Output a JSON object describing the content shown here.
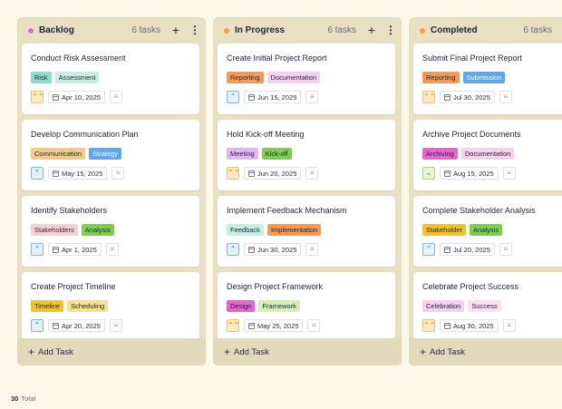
{
  "columns": [
    {
      "title": "Backlog",
      "count": "6 tasks",
      "dot_color": "#d96ad6",
      "add_label": "Add Task",
      "cards": [
        {
          "title": "Conduct Risk Assessment",
          "tags": [
            {
              "label": "Risk",
              "bg": "#8fdcc9"
            },
            {
              "label": "Assessment",
              "bg": "#c6efe2"
            }
          ],
          "priority": "high",
          "date": "Apr 10, 2025"
        },
        {
          "title": "Develop Communication Plan",
          "tags": [
            {
              "label": "Communication",
              "bg": "#f5cb83"
            },
            {
              "label": "Strategy",
              "bg": "#5aa9ef",
              "fg": "#ffffff"
            }
          ],
          "priority": "medium",
          "date": "May 15, 2025"
        },
        {
          "title": "Identify Stakeholders",
          "tags": [
            {
              "label": "Stakeholders",
              "bg": "#f7d0d4"
            },
            {
              "label": "Analysis",
              "bg": "#7bd14b"
            }
          ],
          "priority": "medium",
          "date": "Apr 1, 2025"
        },
        {
          "title": "Create Project Timeline",
          "tags": [
            {
              "label": "Timeline",
              "bg": "#f6c324"
            },
            {
              "label": "Scheduling",
              "bg": "#f8e18c"
            }
          ],
          "priority": "medium",
          "date": "Apr 20, 2025"
        }
      ]
    },
    {
      "title": "In Progress",
      "count": "6 tasks",
      "dot_color": "#f2a23a",
      "add_label": "Add Task",
      "cards": [
        {
          "title": "Create Initial Project Report",
          "tags": [
            {
              "label": "Reporting",
              "bg": "#f59a52"
            },
            {
              "label": "Documentation",
              "bg": "#f7d0ec"
            }
          ],
          "priority": "medium",
          "date": "Jun 15, 2025"
        },
        {
          "title": "Hold Kick-off Meeting",
          "tags": [
            {
              "label": "Meeting",
              "bg": "#e2b6f2"
            },
            {
              "label": "Kick-off",
              "bg": "#7bd14b"
            }
          ],
          "priority": "high",
          "date": "Jun 20, 2025"
        },
        {
          "title": "Implement Feedback Mechanism",
          "tags": [
            {
              "label": "Feedback",
              "bg": "#c6efe2"
            },
            {
              "label": "Implementation",
              "bg": "#f59a52"
            }
          ],
          "priority": "medium",
          "date": "Jun 30, 2025"
        },
        {
          "title": "Design Project Framework",
          "tags": [
            {
              "label": "Design",
              "bg": "#ec63cf"
            },
            {
              "label": "Framework",
              "bg": "#d6f0b4"
            }
          ],
          "priority": "high",
          "date": "May 25, 2025"
        }
      ]
    },
    {
      "title": "Completed",
      "count": "6 tasks",
      "dot_color": "#f2a23a",
      "add_label": "Add Task",
      "cards": [
        {
          "title": "Submit Final Project Report",
          "tags": [
            {
              "label": "Reporting",
              "bg": "#f59a52"
            },
            {
              "label": "Submission",
              "bg": "#5aa9ef",
              "fg": "#ffffff"
            }
          ],
          "priority": "high",
          "date": "Jul 30, 2025"
        },
        {
          "title": "Archive Project Documents",
          "tags": [
            {
              "label": "Archiving",
              "bg": "#ec63cf"
            },
            {
              "label": "Documentation",
              "bg": "#f7d0ec"
            }
          ],
          "priority": "low",
          "date": "Aug 15, 2025"
        },
        {
          "title": "Complete Stakeholder Analysis",
          "tags": [
            {
              "label": "Stakeholder",
              "bg": "#f6c324"
            },
            {
              "label": "Analysis",
              "bg": "#7bd14b"
            }
          ],
          "priority": "medium",
          "date": "Jul 20, 2025"
        },
        {
          "title": "Celebrate Project Success",
          "tags": [
            {
              "label": "Celebration",
              "bg": "#f7d0ec"
            },
            {
              "label": "Success",
              "bg": "#fbe0f2"
            }
          ],
          "priority": "high",
          "date": "Aug 30, 2025"
        }
      ]
    }
  ],
  "priority_styles": {
    "high": {
      "glyph": "⌃⌃",
      "bg": "#fde9c2",
      "border": "#f2c366",
      "color": "#c98a12"
    },
    "medium": {
      "glyph": "⌃",
      "bg": "#e3f1fb",
      "border": "#7bb8e0",
      "color": "#2d7fb8"
    },
    "low": {
      "glyph": "⌄",
      "bg": "#eaf6d5",
      "border": "#a9d66d",
      "color": "#5f9a1e"
    }
  },
  "footer": {
    "total_count": "30",
    "total_label": "Total"
  }
}
